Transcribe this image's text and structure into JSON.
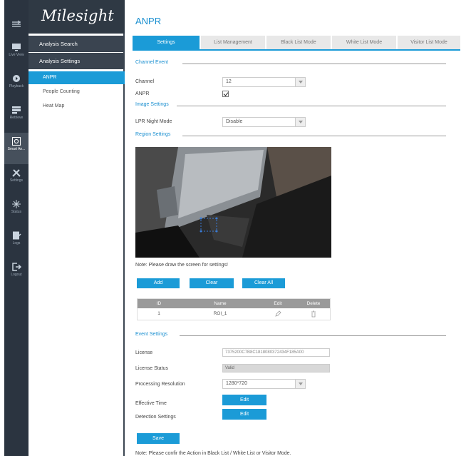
{
  "rail": {
    "items": [
      {
        "label": "",
        "icon": "menu-icon"
      },
      {
        "label": "Live View",
        "icon": "monitor-icon"
      },
      {
        "label": "Playback",
        "icon": "playback-icon"
      },
      {
        "label": "Retrieve",
        "icon": "retrieve-icon"
      },
      {
        "label": "Smart An...",
        "icon": "smart-analysis-icon"
      },
      {
        "label": "Settings",
        "icon": "settings-icon"
      },
      {
        "label": "Status",
        "icon": "status-icon"
      },
      {
        "label": "Logs",
        "icon": "logs-icon"
      },
      {
        "label": "Logout",
        "icon": "logout-icon"
      }
    ]
  },
  "menu": {
    "logo": "Milesight",
    "sections": [
      "Analysis Search",
      "Analysis Settings"
    ],
    "items": [
      "ANPR",
      "People Counting",
      "Heat Map"
    ]
  },
  "page": {
    "title": "ANPR",
    "tabs": [
      "Settings",
      "List Management",
      "Black List Mode",
      "White List Mode",
      "Visitor List Mode"
    ]
  },
  "channel_event": {
    "heading": "Channel Event",
    "channel_label": "Channel",
    "channel_value": "12",
    "anpr_label": "ANPR"
  },
  "image_settings": {
    "heading": "Image Settings",
    "lpr_night_label": "LPR Night Mode",
    "lpr_night_value": "Disable"
  },
  "region_settings": {
    "heading": "Region Settings",
    "note": "Note: Please draw the screen for settings!",
    "add": "Add",
    "clear": "Clear",
    "clear_all": "Clear All",
    "headers": [
      "ID",
      "Name",
      "Edit",
      "Delete"
    ],
    "rows": [
      {
        "id": "1",
        "name": "ROI_1"
      }
    ]
  },
  "event_settings": {
    "heading": "Event Settings",
    "license_label": "License",
    "license_value": "7375200C7B8C1818080372434F185A00",
    "status_label": "License Status",
    "status_value": "Valid",
    "resolution_label": "Processing Resolution",
    "resolution_value": "1280*720",
    "effective_label": "Effective Time",
    "detection_label": "Detection Settings",
    "edit": "Edit"
  },
  "save": "Save",
  "footer_note": "Note: Please confir the Action in Black List / White List or Visitor Mode.",
  "colors": {
    "accent": "#1b9bd7",
    "rail": "#2b3440",
    "logo_bg": "#2f3944"
  }
}
